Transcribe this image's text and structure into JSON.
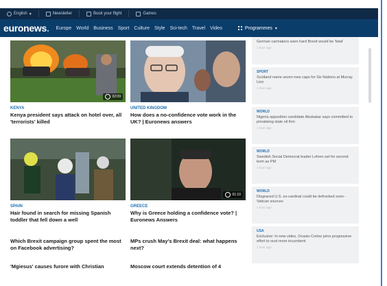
{
  "topbar": {
    "language": "English",
    "newsletter": "Newsletter",
    "book_flight": "Book your flight",
    "games": "Games"
  },
  "nav": {
    "logo_main": "euronews",
    "logo_dot": ".",
    "links": [
      "Europe",
      "World",
      "Business",
      "Sport",
      "Culture",
      "Style",
      "Sci-tech",
      "Travel",
      "Video"
    ],
    "programmes": "Programmes"
  },
  "stories": [
    {
      "tag": "Kenya",
      "headline": "Kenya president says attack on hotel over, all 'terrorists' killed",
      "video_time": "02:09"
    },
    {
      "tag": "United Kingdom",
      "headline": "How does a no-confidence vote work in the UK? | Euronews answers"
    },
    {
      "tag": "Spain",
      "headline": "Hair found in search for missing Spanish toddler that fell down a well"
    },
    {
      "tag": "Greece",
      "headline": "Why is Greece holding a confidence vote? | Euronews Answers",
      "video_time": "01:10"
    }
  ],
  "text_stories": [
    "Which Brexit campaign group spent the most on Facebook advertising?",
    "MPs crush May's Brexit deal: what happens next?",
    "'Mgiesus' causes furore with Christian",
    "Moscow court extends detention of 4"
  ],
  "rail": [
    {
      "tag": "",
      "text": "German carmakers warn hard Brexit would be 'fatal'",
      "time": "1 hour ago"
    },
    {
      "tag": "Sport",
      "text": "Scotland name seven new caps for Six Nations at Murray Lion",
      "time": "1 hour ago"
    },
    {
      "tag": "World",
      "text": "Nigeria opposition candidate Abubakar says committed to privatising state oil firm",
      "time": "1 hour ago"
    },
    {
      "tag": "World",
      "text": "Swedish Social Democrat leader Lofven set for second term as PM",
      "time": "1 hour ago"
    },
    {
      "tag": "World",
      "text": "Disgraced U.S. ex-cardinal could be defrocked soon - Vatican sources",
      "time": "1 hour ago"
    },
    {
      "tag": "USA",
      "text": "Exclusive: In new video, Ocasio-Cortez joins progressive effort to oust more incumbent",
      "time": "1 hour ago"
    }
  ],
  "colors": {
    "nav_bg": "#0b3d6b",
    "topbar_bg": "#0f2a46",
    "accent": "#1f6fb0"
  }
}
